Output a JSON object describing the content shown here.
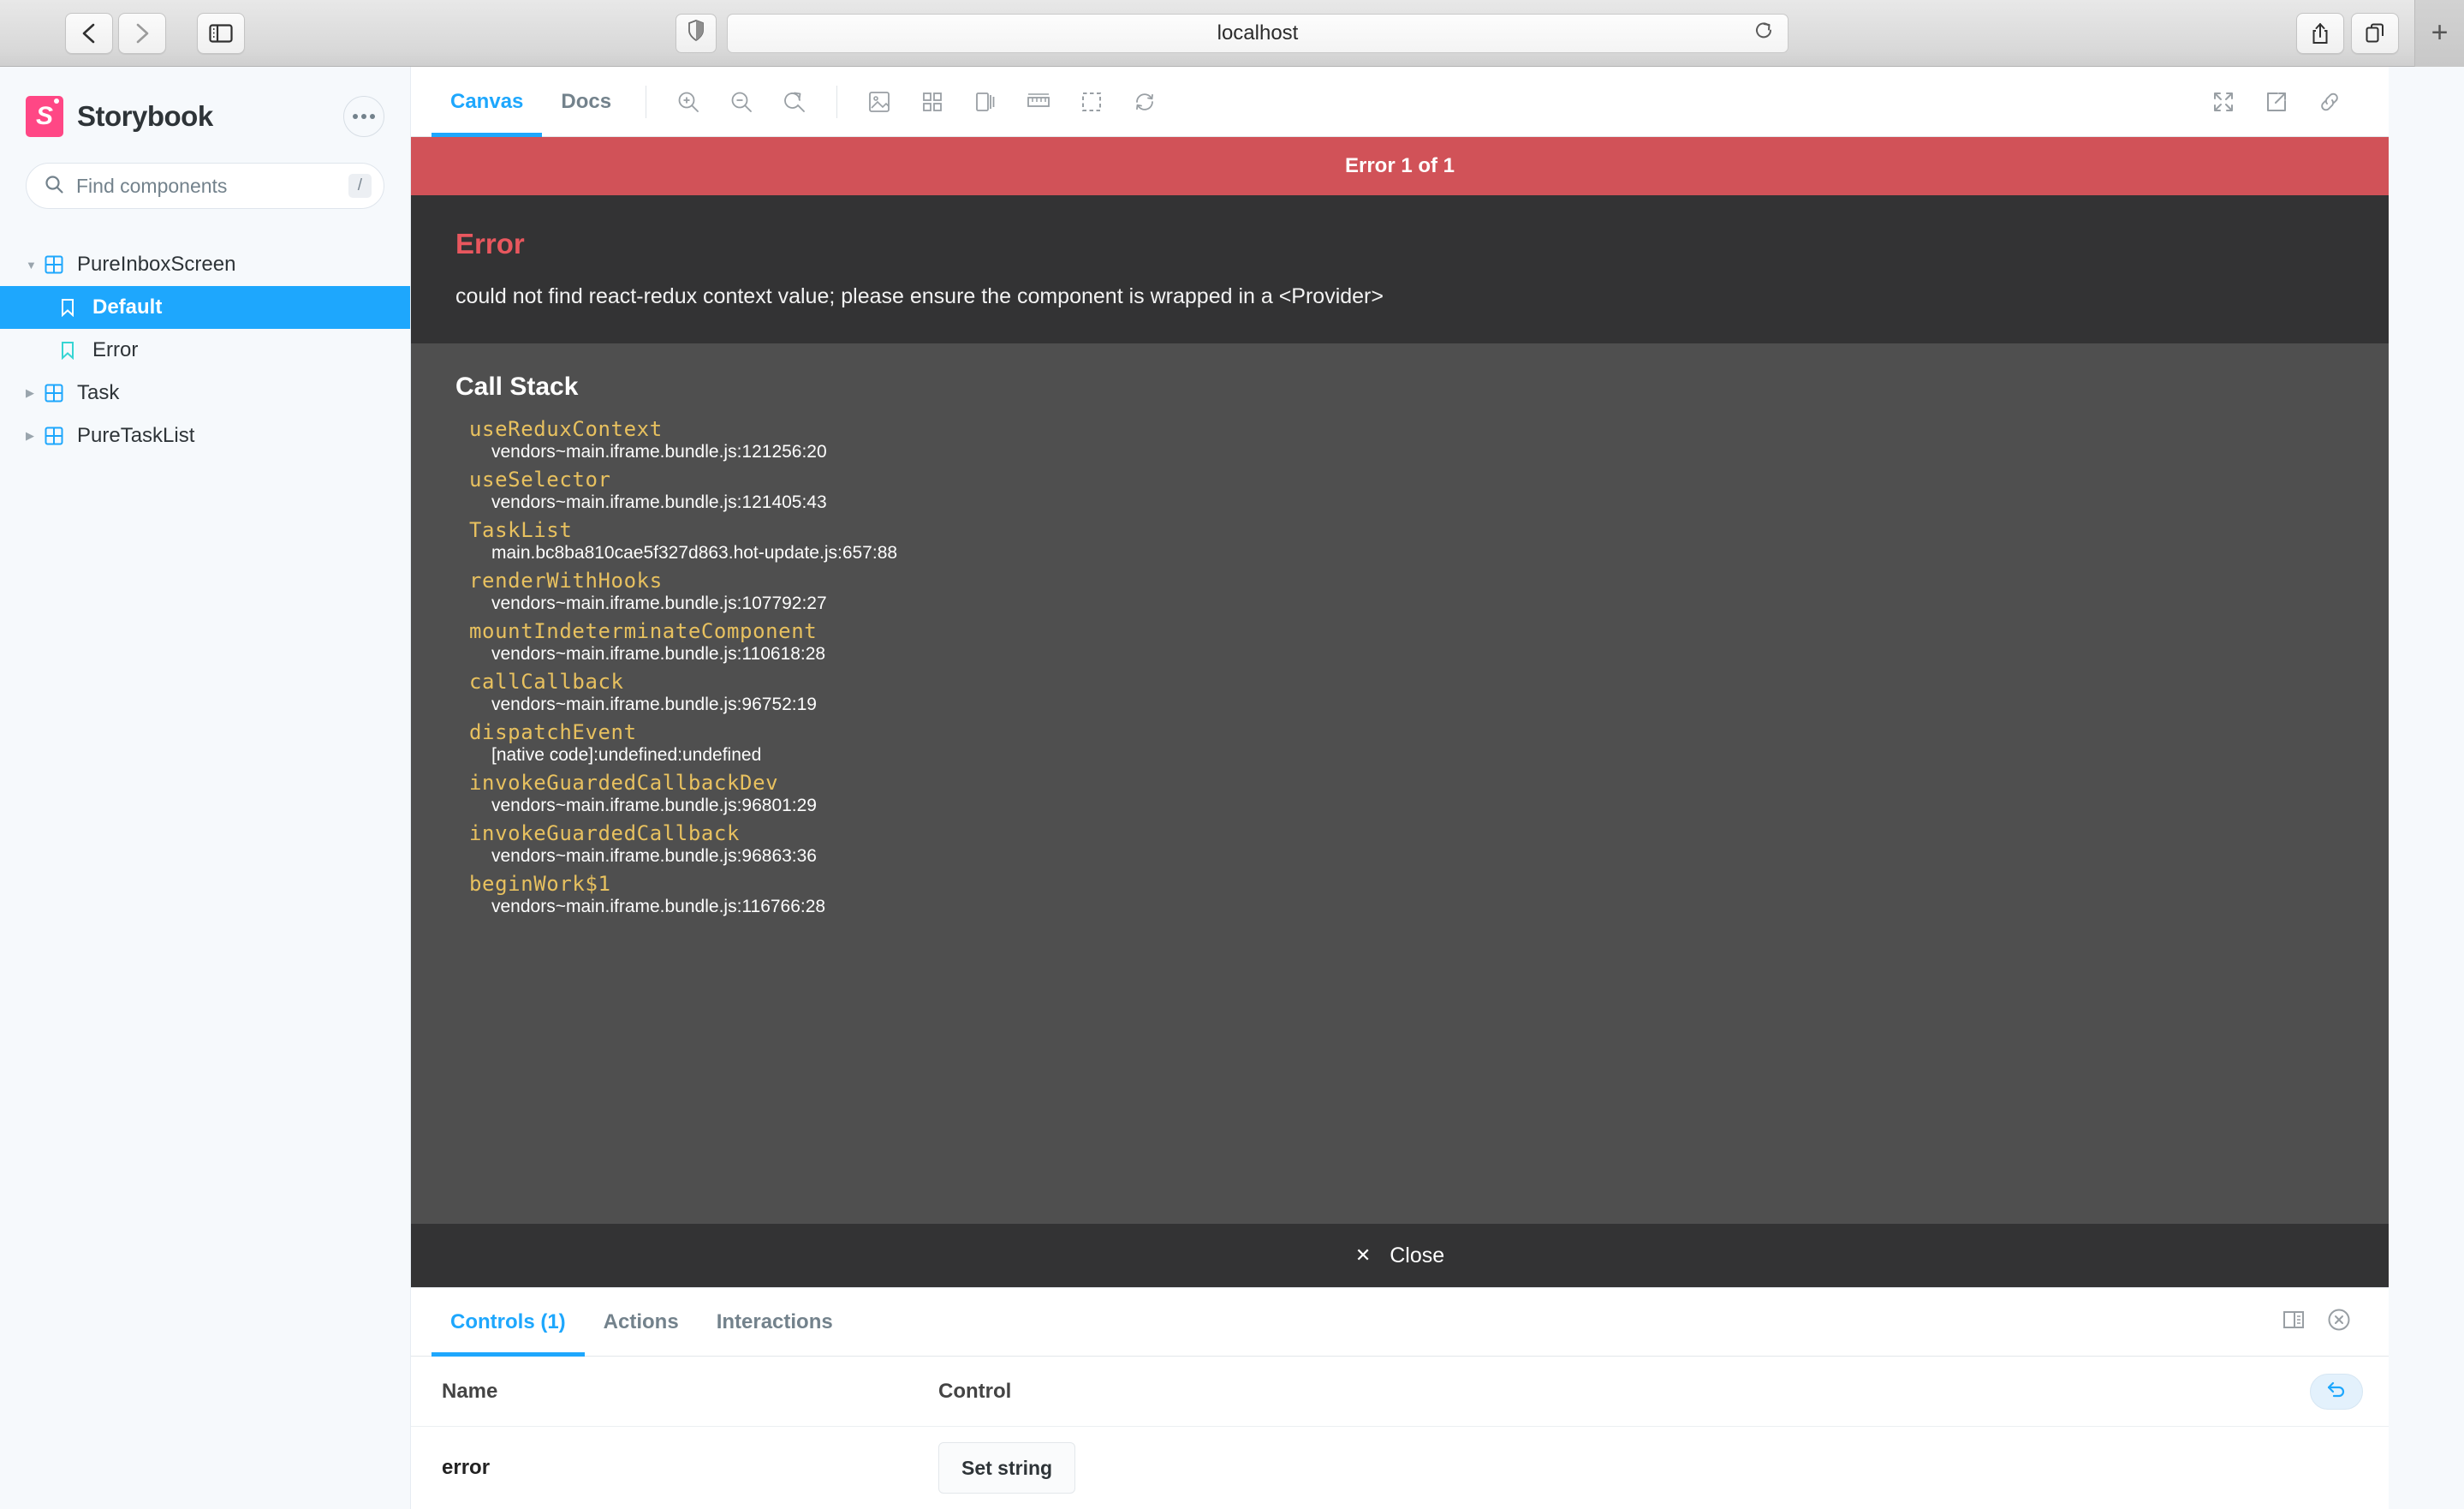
{
  "browser": {
    "url_value": "localhost",
    "back_icon": "chevron-left-icon",
    "forward_icon": "chevron-right-icon",
    "sidebar_icon": "sidebar-toggle-icon",
    "shield_icon": "privacy-shield-icon",
    "reload_icon": "reload-icon",
    "share_icon": "share-icon",
    "tabs_icon": "tab-overview-icon",
    "new_tab_label": "+"
  },
  "sidebar": {
    "brand": "Storybook",
    "logo_icon": "storybook-logo-icon",
    "menu_icon": "more-options-icon",
    "search": {
      "placeholder": "Find components",
      "icon": "search-icon",
      "shortcut": "/"
    },
    "tree": [
      {
        "label": "PureInboxScreen",
        "kind": "component",
        "depth": 0,
        "expanded": true,
        "selected": false
      },
      {
        "label": "Default",
        "kind": "story",
        "depth": 1,
        "expanded": false,
        "selected": true
      },
      {
        "label": "Error",
        "kind": "story",
        "depth": 1,
        "expanded": false,
        "selected": false
      },
      {
        "label": "Task",
        "kind": "component",
        "depth": 0,
        "expanded": false,
        "selected": false
      },
      {
        "label": "PureTaskList",
        "kind": "component",
        "depth": 0,
        "expanded": false,
        "selected": false
      }
    ]
  },
  "canvas_toolbar": {
    "tabs": [
      {
        "label": "Canvas",
        "active": true
      },
      {
        "label": "Docs",
        "active": false
      }
    ],
    "tools": [
      "zoom-in-icon",
      "zoom-out-icon",
      "zoom-reset-icon",
      "background-icon",
      "grid-icon",
      "viewport-icon",
      "measure-icon",
      "outline-icon",
      "refresh-icon"
    ],
    "right_tools": [
      "fullscreen-icon",
      "open-new-tab-icon",
      "copy-link-icon"
    ]
  },
  "error_overlay": {
    "banner": "Error 1 of 1",
    "title": "Error",
    "message": "could not find react-redux context value; please ensure the component is wrapped in a <Provider>",
    "stack_title": "Call Stack",
    "frames": [
      {
        "fn": "useReduxContext",
        "src": "vendors~main.iframe.bundle.js:121256:20"
      },
      {
        "fn": "useSelector",
        "src": "vendors~main.iframe.bundle.js:121405:43"
      },
      {
        "fn": "TaskList",
        "src": "main.bc8ba810cae5f327d863.hot-update.js:657:88"
      },
      {
        "fn": "renderWithHooks",
        "src": "vendors~main.iframe.bundle.js:107792:27"
      },
      {
        "fn": "mountIndeterminateComponent",
        "src": "vendors~main.iframe.bundle.js:110618:28"
      },
      {
        "fn": "callCallback",
        "src": "vendors~main.iframe.bundle.js:96752:19"
      },
      {
        "fn": "dispatchEvent",
        "src": "[native code]:undefined:undefined"
      },
      {
        "fn": "invokeGuardedCallbackDev",
        "src": "vendors~main.iframe.bundle.js:96801:29"
      },
      {
        "fn": "invokeGuardedCallback",
        "src": "vendors~main.iframe.bundle.js:96863:36"
      },
      {
        "fn": "beginWork$1",
        "src": "vendors~main.iframe.bundle.js:116766:28"
      }
    ],
    "close_label": "Close",
    "close_icon": "close-x-icon"
  },
  "addon_panel": {
    "tabs": [
      {
        "label": "Controls (1)",
        "active": true
      },
      {
        "label": "Actions",
        "active": false
      },
      {
        "label": "Interactions",
        "active": false
      }
    ],
    "layout_icon": "panel-position-icon",
    "close_icon": "close-circle-icon",
    "table": {
      "headers": [
        "Name",
        "Control"
      ],
      "reset_icon": "reset-controls-icon",
      "rows": [
        {
          "name": "error",
          "control_label": "Set string"
        }
      ]
    }
  },
  "colors": {
    "accent": "#1ea7fd",
    "brand": "#ff4785",
    "error_banner": "#d15258",
    "error_title": "#e8575e",
    "overlay_dark": "#333334",
    "overlay_body": "#4f4f4f",
    "stack_fn": "#e8c15f",
    "sidebar_bg": "#f6f9fc"
  }
}
